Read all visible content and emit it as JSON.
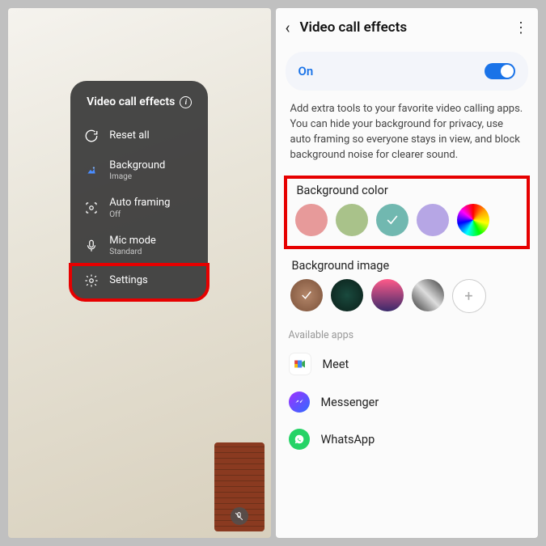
{
  "left": {
    "title": "Video call effects",
    "reset": "Reset all",
    "background": {
      "label": "Background",
      "sub": "Image"
    },
    "autoframing": {
      "label": "Auto framing",
      "sub": "Off"
    },
    "micmode": {
      "label": "Mic mode",
      "sub": "Standard"
    },
    "settings": "Settings"
  },
  "right": {
    "title": "Video call effects",
    "toggle_label": "On",
    "description": "Add extra tools to your favorite video calling apps. You can hide your background for privacy, use auto framing so everyone stays in view, and block background noise for clearer sound.",
    "bgcolor_title": "Background color",
    "colors": [
      "#e79a9a",
      "#a9c28a",
      "#71b8b0",
      "#b6a6e5",
      "rainbow"
    ],
    "selected_color_index": 2,
    "bgimage_title": "Background image",
    "selected_image_index": 0,
    "available_apps_title": "Available apps",
    "apps": [
      {
        "name": "Meet"
      },
      {
        "name": "Messenger"
      },
      {
        "name": "WhatsApp"
      }
    ]
  }
}
